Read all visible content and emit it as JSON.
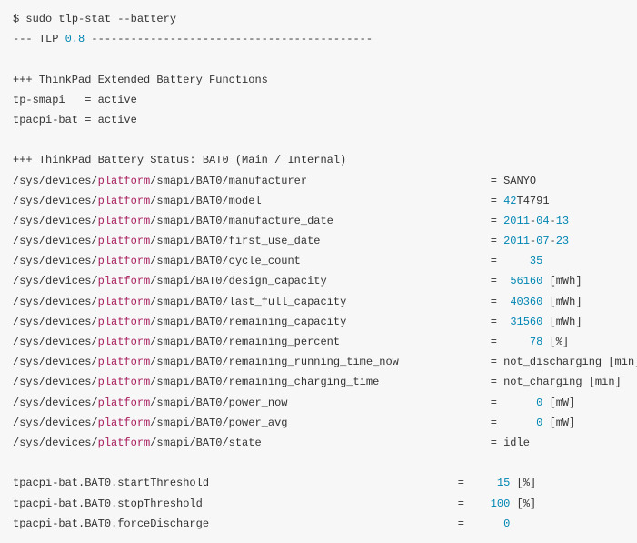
{
  "prompt": "$",
  "command": "sudo tlp-stat --battery",
  "tlp_line": {
    "prefix": "--- TLP ",
    "version": "0.8",
    "dashes": " -------------------------------------------"
  },
  "section_ext": "+++ ThinkPad Extended Battery Functions",
  "ext": {
    "tp_smapi_label": "tp-smapi   = ",
    "tp_smapi_value": "active",
    "tpacpi_label": "tpacpi-bat = ",
    "tpacpi_value": "active"
  },
  "section_bat": "+++ ThinkPad Battery Status: BAT0 (Main / Internal)",
  "path": {
    "pre": "/sys/devices/",
    "mid": "platform",
    "post": "/smapi/BAT0/"
  },
  "rows": {
    "manufacturer": {
      "attr": "manufacturer                            ",
      "eq": "= ",
      "val": "SANYO",
      "unit": ""
    },
    "model": {
      "attr": "model                                   ",
      "eq": "= ",
      "valpre": "42",
      "val": "T4791",
      "unit": ""
    },
    "manufacture_date": {
      "attr": "manufacture_date                        ",
      "eq": "= ",
      "y": "2011",
      "d1": "-",
      "m": "04",
      "d2": "-",
      "d": "13",
      "unit": ""
    },
    "first_use_date": {
      "attr": "first_use_date                          ",
      "eq": "= ",
      "y": "2011",
      "d1": "-",
      "m": "07",
      "d2": "-",
      "d": "23",
      "unit": ""
    },
    "cycle_count": {
      "attr": "cycle_count                             ",
      "eq": "=     ",
      "val": "35",
      "unit": ""
    },
    "design_capacity": {
      "attr": "design_capacity                         ",
      "eq": "=  ",
      "val": "56160",
      "unit": " [mWh]"
    },
    "last_full_capacity": {
      "attr": "last_full_capacity                      ",
      "eq": "=  ",
      "val": "40360",
      "unit": " [mWh]"
    },
    "remaining_capacity": {
      "attr": "remaining_capacity                      ",
      "eq": "=  ",
      "val": "31560",
      "unit": " [mWh]"
    },
    "remaining_percent": {
      "attr": "remaining_percent                       ",
      "eq": "=     ",
      "val": "78",
      "unit": " [%]"
    },
    "remaining_running_time_now": {
      "attr": "remaining_running_time_now              ",
      "eq": "= ",
      "val": "not_discharging",
      "unit": " [min]"
    },
    "remaining_charging_time": {
      "attr": "remaining_charging_time                 ",
      "eq": "= ",
      "val": "not_charging",
      "unit": " [min]"
    },
    "power_now": {
      "attr": "power_now                               ",
      "eq": "=      ",
      "val": "0",
      "unit": " [mW]"
    },
    "power_avg": {
      "attr": "power_avg                               ",
      "eq": "=      ",
      "val": "0",
      "unit": " [mW]"
    },
    "state": {
      "attr": "state                                   ",
      "eq": "= ",
      "val": "idle",
      "unit": ""
    }
  },
  "tpacpi": {
    "start": {
      "label": "tpacpi-bat.BAT0.startThreshold                                      ",
      "eq": "=     ",
      "val": "15",
      "unit": " [%]"
    },
    "stop": {
      "label": "tpacpi-bat.BAT0.stopThreshold                                       ",
      "eq": "=    ",
      "val": "100",
      "unit": " [%]"
    },
    "force": {
      "label": "tpacpi-bat.BAT0.forceDischarge                                      ",
      "eq": "=      ",
      "val": "0",
      "unit": ""
    }
  }
}
